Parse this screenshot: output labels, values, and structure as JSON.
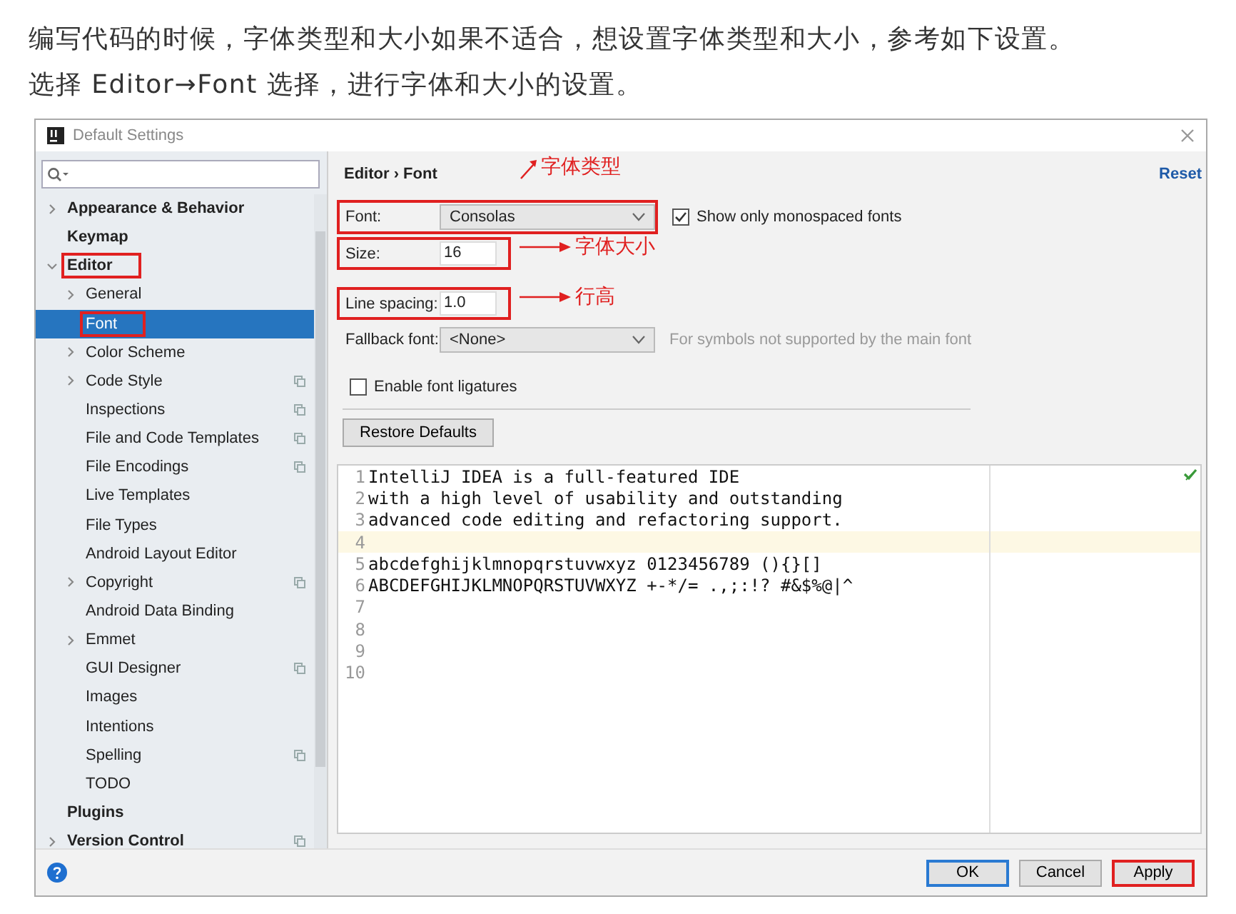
{
  "intro": [
    "编写代码的时候，字体类型和大小如果不适合，想设置字体类型和大小，参考如下设置。",
    "选择 Editor→Font 选择，进行字体和大小的设置。"
  ],
  "dialog": {
    "title": "Default Settings",
    "sidebar": {
      "items": [
        {
          "label": "Appearance & Behavior",
          "expandable": true,
          "expanded": false,
          "selected": false,
          "highlighted": false,
          "shared": false
        },
        {
          "label": "Keymap",
          "expandable": false,
          "selected": false,
          "highlighted": false,
          "shared": false
        },
        {
          "label": "Editor",
          "expandable": true,
          "expanded": true,
          "selected": false,
          "highlighted": true,
          "shared": false,
          "children": [
            {
              "label": "General",
              "expandable": true,
              "expanded": false,
              "selected": false,
              "highlighted": false,
              "shared": false
            },
            {
              "label": "Font",
              "expandable": false,
              "selected": true,
              "highlighted": true,
              "shared": false
            },
            {
              "label": "Color Scheme",
              "expandable": true,
              "expanded": false,
              "selected": false,
              "highlighted": false,
              "shared": false
            },
            {
              "label": "Code Style",
              "expandable": true,
              "expanded": false,
              "selected": false,
              "highlighted": false,
              "shared": true
            },
            {
              "label": "Inspections",
              "expandable": false,
              "selected": false,
              "highlighted": false,
              "shared": true
            },
            {
              "label": "File and Code Templates",
              "expandable": false,
              "selected": false,
              "highlighted": false,
              "shared": true
            },
            {
              "label": "File Encodings",
              "expandable": false,
              "selected": false,
              "highlighted": false,
              "shared": true
            },
            {
              "label": "Live Templates",
              "expandable": false,
              "selected": false,
              "highlighted": false,
              "shared": false
            },
            {
              "label": "File Types",
              "expandable": false,
              "selected": false,
              "highlighted": false,
              "shared": false
            },
            {
              "label": "Android Layout Editor",
              "expandable": false,
              "selected": false,
              "highlighted": false,
              "shared": false
            },
            {
              "label": "Copyright",
              "expandable": true,
              "expanded": false,
              "selected": false,
              "highlighted": false,
              "shared": true
            },
            {
              "label": "Android Data Binding",
              "expandable": false,
              "selected": false,
              "highlighted": false,
              "shared": false
            },
            {
              "label": "Emmet",
              "expandable": true,
              "expanded": false,
              "selected": false,
              "highlighted": false,
              "shared": false
            },
            {
              "label": "GUI Designer",
              "expandable": false,
              "selected": false,
              "highlighted": false,
              "shared": true
            },
            {
              "label": "Images",
              "expandable": false,
              "selected": false,
              "highlighted": false,
              "shared": false
            },
            {
              "label": "Intentions",
              "expandable": false,
              "selected": false,
              "highlighted": false,
              "shared": false
            },
            {
              "label": "Spelling",
              "expandable": false,
              "selected": false,
              "highlighted": false,
              "shared": true
            },
            {
              "label": "TODO",
              "expandable": false,
              "selected": false,
              "highlighted": false,
              "shared": false
            }
          ]
        },
        {
          "label": "Plugins",
          "expandable": false,
          "selected": false,
          "highlighted": false,
          "shared": false
        },
        {
          "label": "Version Control",
          "expandable": true,
          "expanded": false,
          "selected": false,
          "highlighted": false,
          "shared": true
        }
      ]
    },
    "breadcrumb": "Editor › Font",
    "reset": "Reset",
    "fields": [
      {
        "kind": "dropdown",
        "label": "Font:",
        "value": "Consolas",
        "highlighted": true,
        "annotation": {
          "text": "字体类型"
        },
        "checkbox": {
          "label": "Show only monospaced fonts",
          "checked": true
        }
      },
      {
        "kind": "text",
        "label": "Size:",
        "value": "16",
        "highlighted": true,
        "annotation": {
          "text": "字体大小"
        }
      },
      {
        "kind": "text",
        "label": "Line spacing:",
        "value": "1.0",
        "highlighted": true,
        "annotation": {
          "text": "行高"
        }
      },
      {
        "kind": "dropdown",
        "label": "Fallback font:",
        "value": "<None>",
        "highlighted": false,
        "hint": "For symbols not supported by the main font"
      }
    ],
    "ligatures": {
      "label": "Enable font ligatures",
      "checked": false
    },
    "restore_button": "Restore Defaults",
    "preview": {
      "lines": [
        {
          "number": "1",
          "text": "IntelliJ IDEA is a full-featured IDE",
          "current": false
        },
        {
          "number": "2",
          "text": "with a high level of usability and outstanding",
          "current": false
        },
        {
          "number": "3",
          "text": "advanced code editing and refactoring support.",
          "current": false
        },
        {
          "number": "4",
          "current": true
        },
        {
          "number": "5",
          "text": "abcdefghijklmnopqrstuvwxyz 0123456789 (){}[]",
          "current": false
        },
        {
          "number": "6",
          "text": "ABCDEFGHIJKLMNOPQRSTUVWXYZ +-*/= .,;:!? #&$%@|^",
          "current": false
        },
        {
          "number": "7",
          "current": false
        },
        {
          "number": "8",
          "current": false
        },
        {
          "number": "9",
          "current": false
        },
        {
          "number": "10",
          "current": false
        }
      ]
    },
    "buttons": [
      {
        "label": "OK",
        "kind": "default",
        "highlighted": false
      },
      {
        "label": "Cancel",
        "kind": "plain",
        "highlighted": false
      },
      {
        "label": "Apply",
        "kind": "plain",
        "highlighted": true
      }
    ]
  }
}
